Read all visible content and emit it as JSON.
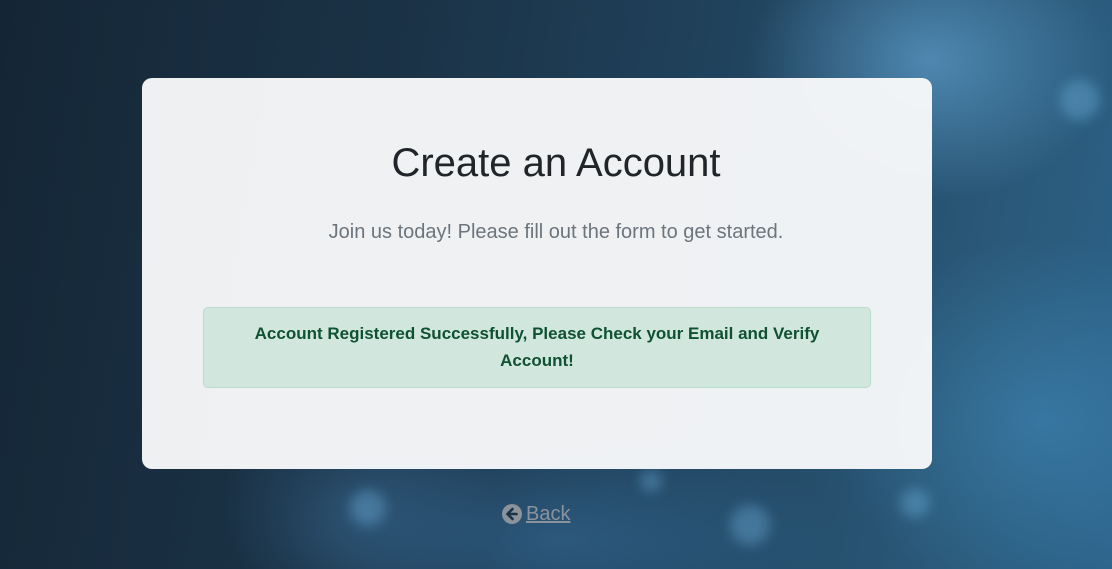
{
  "page": {
    "title": "Create an Account",
    "subtitle": "Join us today! Please fill out the form to get started."
  },
  "alert": {
    "message": "Account Registered Successfully, Please Check your Email and Verify Account!",
    "type": "success"
  },
  "back_link": {
    "label": "Back",
    "icon": "arrow-circle-left-icon"
  },
  "colors": {
    "alert_background": "#d1e7dd",
    "alert_text": "#0f5132",
    "link": "#8a939c"
  }
}
